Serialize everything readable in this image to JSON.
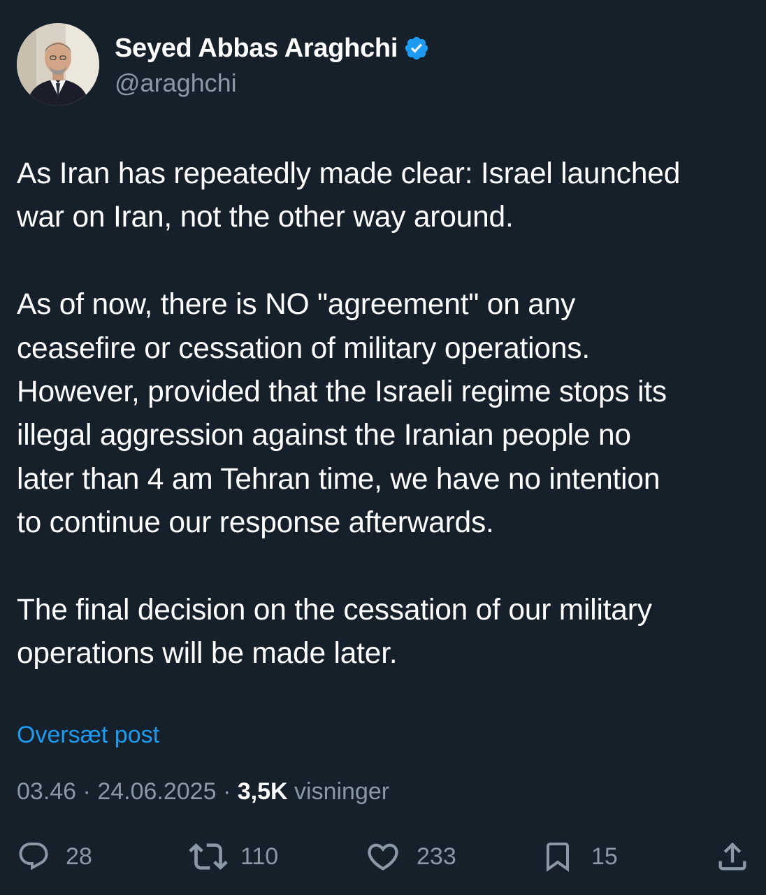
{
  "author": {
    "display_name": "Seyed Abbas Araghchi",
    "handle": "@araghchi",
    "verified": true,
    "avatar_icon": "profile-photo"
  },
  "post": {
    "paragraphs": [
      "As Iran has repeatedly made clear: Israel launched\nwar on Iran, not the other way around.",
      "As of now, there is NO \"agreement\" on any\nceasefire or cessation of military operations.\nHowever, provided that the Israeli regime stops its\nillegal aggression against the Iranian people no\nlater than 4 am Tehran time, we have no intention\nto continue our response afterwards.",
      "The final decision on the cessation of our military\noperations will be made later."
    ],
    "translate_label": "Oversæt post"
  },
  "meta": {
    "time": "03.46",
    "separator": "·",
    "date": "24.06.2025",
    "views_count": "3,5K",
    "views_label": "visninger"
  },
  "actions": {
    "replies": "28",
    "reposts": "110",
    "likes": "233",
    "bookmarks": "15"
  },
  "colors": {
    "background": "#15202b",
    "text": "#ffffff",
    "secondary": "#8b98a5",
    "accent": "#1d9bf0"
  }
}
